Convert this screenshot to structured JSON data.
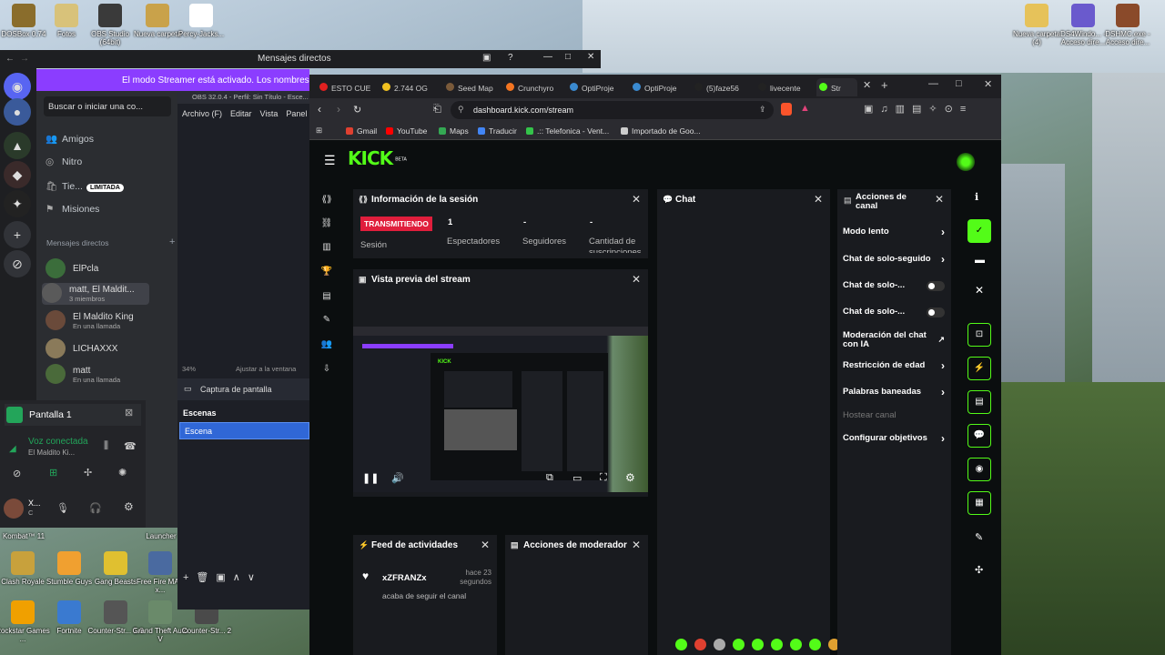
{
  "desktop": {
    "icons_top_left": [
      {
        "label": "DOSBox 0.74",
        "color": "#8a6d2c"
      },
      {
        "label": "Fotos",
        "color": "#d8c27a"
      },
      {
        "label": "OBS Studio (64bit)",
        "color": "#3a3a3a"
      },
      {
        "label": "Nueva carpeta",
        "color": "#c9a24a"
      },
      {
        "label": "Percy-Jacks...",
        "color": "#ffffff"
      }
    ],
    "icons_top_right": [
      {
        "label": "Nueva carpeta (4)",
        "color": "#e6c25a"
      },
      {
        "label": "DS4Windo... - Acceso dire...",
        "color": "#6a5acd"
      },
      {
        "label": "DSHMC.exe - Acceso dire...",
        "color": "#8a4a2a"
      }
    ],
    "icons_bottom": [
      {
        "label": "Clash Royale",
        "color": "#c8a13c"
      },
      {
        "label": "Stumble Guys",
        "color": "#f0a030"
      },
      {
        "label": "Gang Beasts",
        "color": "#e0c030"
      },
      {
        "label": "Free Fire MAX x...",
        "color": "#4a6aa0"
      },
      {
        "label": "Rockstar Games ...",
        "color": "#f0a000"
      },
      {
        "label": "Fortnite",
        "color": "#3a7ad0"
      },
      {
        "label": "Counter-Str... 1.6",
        "color": "#555555"
      },
      {
        "label": "Grand Theft Auto V",
        "color": "#6a8a6a"
      },
      {
        "label": "Counter-Str... 2",
        "color": "#4a4a4a"
      }
    ],
    "partial_labels": [
      "Kombat™ 11",
      "Launcher"
    ]
  },
  "discord": {
    "window_title": "Mensajes directos",
    "banner": "El modo Streamer está activado. Los nombres de us...",
    "search": "Buscar o iniciar una co...",
    "nav": [
      {
        "icon": "friends-icon",
        "glyph": "👥",
        "label": "Amigos"
      },
      {
        "icon": "nitro-icon",
        "glyph": "◎",
        "label": "Nitro"
      },
      {
        "icon": "shop-icon",
        "glyph": "🛍",
        "label": "Tie...",
        "badge": "LIMITADA"
      },
      {
        "icon": "quests-icon",
        "glyph": "⚑",
        "label": "Misiones"
      }
    ],
    "dm_header": "Mensajes directos",
    "dm_add": "+",
    "dms": [
      {
        "name": "ElPcla",
        "sub": "",
        "color": "#3b6d3b"
      },
      {
        "name": "matt, El Maldit...",
        "sub": "3 miembros",
        "color": "#5a5a5a"
      },
      {
        "name": "El Maldito King",
        "sub": "En una llamada",
        "color": "#6a4a3a"
      },
      {
        "name": "LICHAXXX",
        "sub": "",
        "color": "#8a7a5a"
      },
      {
        "name": "matt",
        "sub": "En una llamada",
        "color": "#4a6a3a"
      }
    ],
    "screen_share": "Pantalla 1",
    "voice_status": "Voz conectada",
    "voice_sub": "El Maldito Ki...",
    "user_name": "X...",
    "user_sub": "C"
  },
  "obs": {
    "title": "OBS 32.0.4 - Perfil: Sin Título - Esce...",
    "menu": [
      "Archivo (F)",
      "Editar",
      "Vista",
      "Panel"
    ],
    "zoom": "34%",
    "zoom_label": "Ajustar a la ventana",
    "source": "Captura de pantalla",
    "scenes_header": "Escenas",
    "scene_selected": "Escena"
  },
  "browser": {
    "tabs": [
      {
        "label": "ESTO CUE",
        "color": "#e02020"
      },
      {
        "label": "2.744 OG",
        "color": "#f0c020"
      },
      {
        "label": "Seed Map",
        "color": "#7a5a3a"
      },
      {
        "label": "Crunchyro",
        "color": "#f47521"
      },
      {
        "label": "OptiProje",
        "color": "#3a8ad0"
      },
      {
        "label": "OptiProje",
        "color": "#3a8ad0"
      },
      {
        "label": "(5)faze56",
        "color": "#222222"
      },
      {
        "label": "livecente",
        "color": "#222222"
      },
      {
        "label": "Str",
        "color": "#53fc18"
      }
    ],
    "url": "dashboard.kick.com/stream",
    "bookmarks": [
      {
        "label": "Gmail",
        "color": "#e04030"
      },
      {
        "label": "YouTube",
        "color": "#ff0000"
      },
      {
        "label": "Maps",
        "color": "#34a853"
      },
      {
        "label": "Traducir",
        "color": "#4285f4"
      },
      {
        "label": ".:: Telefonica - Vent...",
        "color": "#34c34a"
      },
      {
        "label": "Importado de Goo...",
        "color": "#cccccc"
      }
    ]
  },
  "kick": {
    "logo": "KICK",
    "logo_beta": "BETA",
    "accent": "#53fc18",
    "session": {
      "title": "Información de la sesión",
      "status": "TRANSMITIENDO",
      "status_label": "Sesión",
      "viewers_value": "1",
      "viewers_label": "Espectadores",
      "followers_value": "-",
      "followers_label": "Seguidores",
      "subs_value": "-",
      "subs_label": "Cantidad de suscripciones"
    },
    "preview": {
      "title": "Vista previa del stream",
      "header_kick": "KICK"
    },
    "chat": {
      "title": "Chat"
    },
    "channel_actions": {
      "title": "Acciones de canal",
      "items": [
        {
          "label": "Modo lento",
          "type": "chevron"
        },
        {
          "label": "Chat de solo-seguido",
          "type": "chevron"
        },
        {
          "label": "Chat de solo-...",
          "type": "toggle"
        },
        {
          "label": "Chat de solo-...",
          "type": "toggle"
        },
        {
          "label": "Moderación del chat con IA",
          "type": "external"
        },
        {
          "label": "Restricción de edad",
          "type": "chevron"
        },
        {
          "label": "Palabras baneadas",
          "type": "chevron"
        },
        {
          "label": "Hostear canal",
          "type": "disabled"
        },
        {
          "label": "Configurar objetivos",
          "type": "chevron"
        }
      ]
    },
    "feed": {
      "title": "Feed de actividades",
      "user": "xZFRANZx",
      "time": "hace 23 segundos",
      "event": "acaba de seguir el canal"
    },
    "mod": {
      "title": "Acciones de moderador"
    }
  }
}
